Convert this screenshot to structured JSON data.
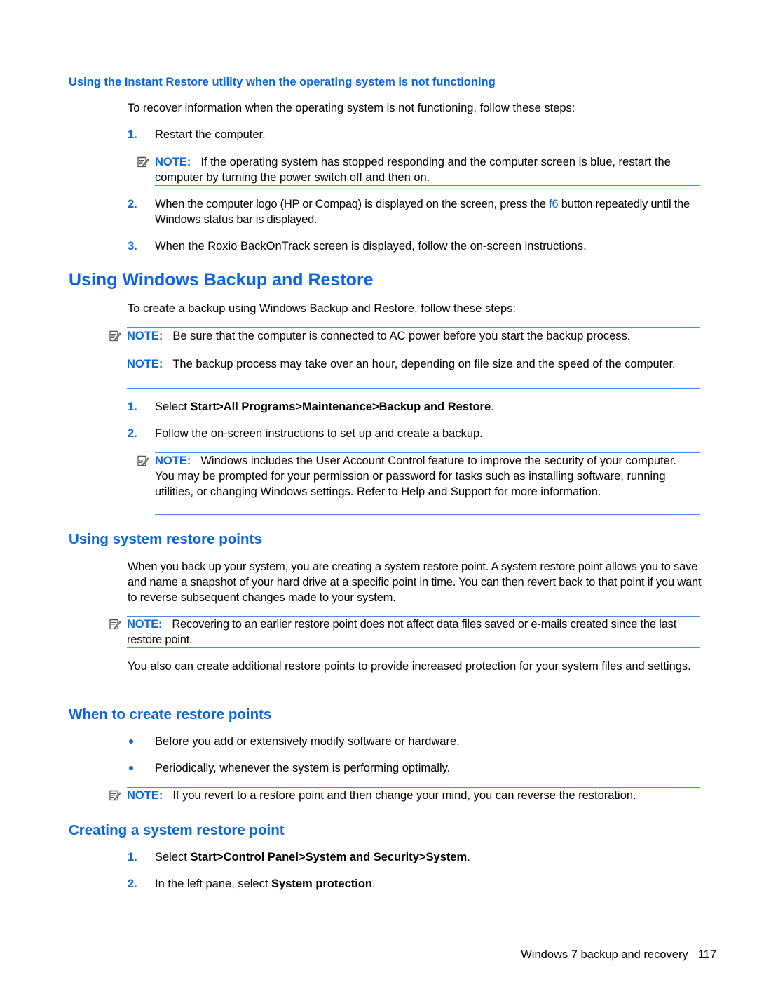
{
  "section_instant": {
    "heading": "Using the Instant Restore utility when the operating system is not functioning",
    "intro": "To recover information when the operating system is not functioning, follow these steps:",
    "steps": [
      {
        "num": "1.",
        "text": "Restart the computer."
      },
      {
        "num": "2.",
        "text_before": "When the computer logo (HP or Compaq) is displayed on the screen, press the ",
        "key": "f6",
        "text_after": " button repeatedly until the Windows status bar is displayed."
      },
      {
        "num": "3.",
        "text": "When the Roxio BackOnTrack screen is displayed, follow the on-screen instructions."
      }
    ],
    "note": {
      "label": "NOTE:",
      "text": "If the operating system has stopped responding and the computer screen is blue, restart the computer by turning the power switch off and then on."
    }
  },
  "section_backup": {
    "heading": "Using Windows Backup and Restore",
    "intro": "To create a backup using Windows Backup and Restore, follow these steps:",
    "notes": [
      {
        "label": "NOTE:",
        "text": "Be sure that the computer is connected to AC power before you start the backup process."
      },
      {
        "label": "NOTE:",
        "text": "The backup process may take over an hour, depending on file size and the speed of the computer."
      }
    ],
    "steps": [
      {
        "num": "1.",
        "prefix": "Select ",
        "bold": "Start>All Programs>Maintenance>Backup and Restore",
        "suffix": "."
      },
      {
        "num": "2.",
        "text": "Follow the on-screen instructions to set up and create a backup."
      }
    ],
    "step_note": {
      "label": "NOTE:",
      "text": "Windows includes the User Account Control feature to improve the security of your computer. You may be prompted for your permission or password for tasks such as installing software, running utilities, or changing Windows settings. Refer to Help and Support for more information."
    }
  },
  "section_restore_points": {
    "heading": "Using system restore points",
    "para1": "When you back up your system, you are creating a system restore point. A system restore point allows you to save and name a snapshot of your hard drive at a specific point in time. You can then revert back to that point if you want to reverse subsequent changes made to your system.",
    "note": {
      "label": "NOTE:",
      "text": "Recovering to an earlier restore point does not affect data files saved or e-mails created since the last restore point."
    },
    "para2": "You also can create additional restore points to provide increased protection for your system files and settings."
  },
  "section_when": {
    "heading": "When to create restore points",
    "bullets": [
      "Before you add or extensively modify software or hardware.",
      "Periodically, whenever the system is performing optimally."
    ],
    "note": {
      "label": "NOTE:",
      "text": "If you revert to a restore point and then change your mind, you can reverse the restoration."
    }
  },
  "section_creating": {
    "heading": "Creating a system restore point",
    "steps": [
      {
        "num": "1.",
        "prefix": "Select ",
        "bold": "Start>Control Panel>System and Security>System",
        "suffix": "."
      },
      {
        "num": "2.",
        "prefix": "In the left pane, select ",
        "bold": "System protection",
        "suffix": "."
      }
    ]
  },
  "footer": {
    "chapter": "Windows 7 backup and recovery",
    "page": "117"
  },
  "icons": {
    "note": "note-pad-icon",
    "bullet": "bullet-dot"
  },
  "colors": {
    "accent": "#0a64e6",
    "rule": "#4a8ae8",
    "text": "#000000"
  }
}
